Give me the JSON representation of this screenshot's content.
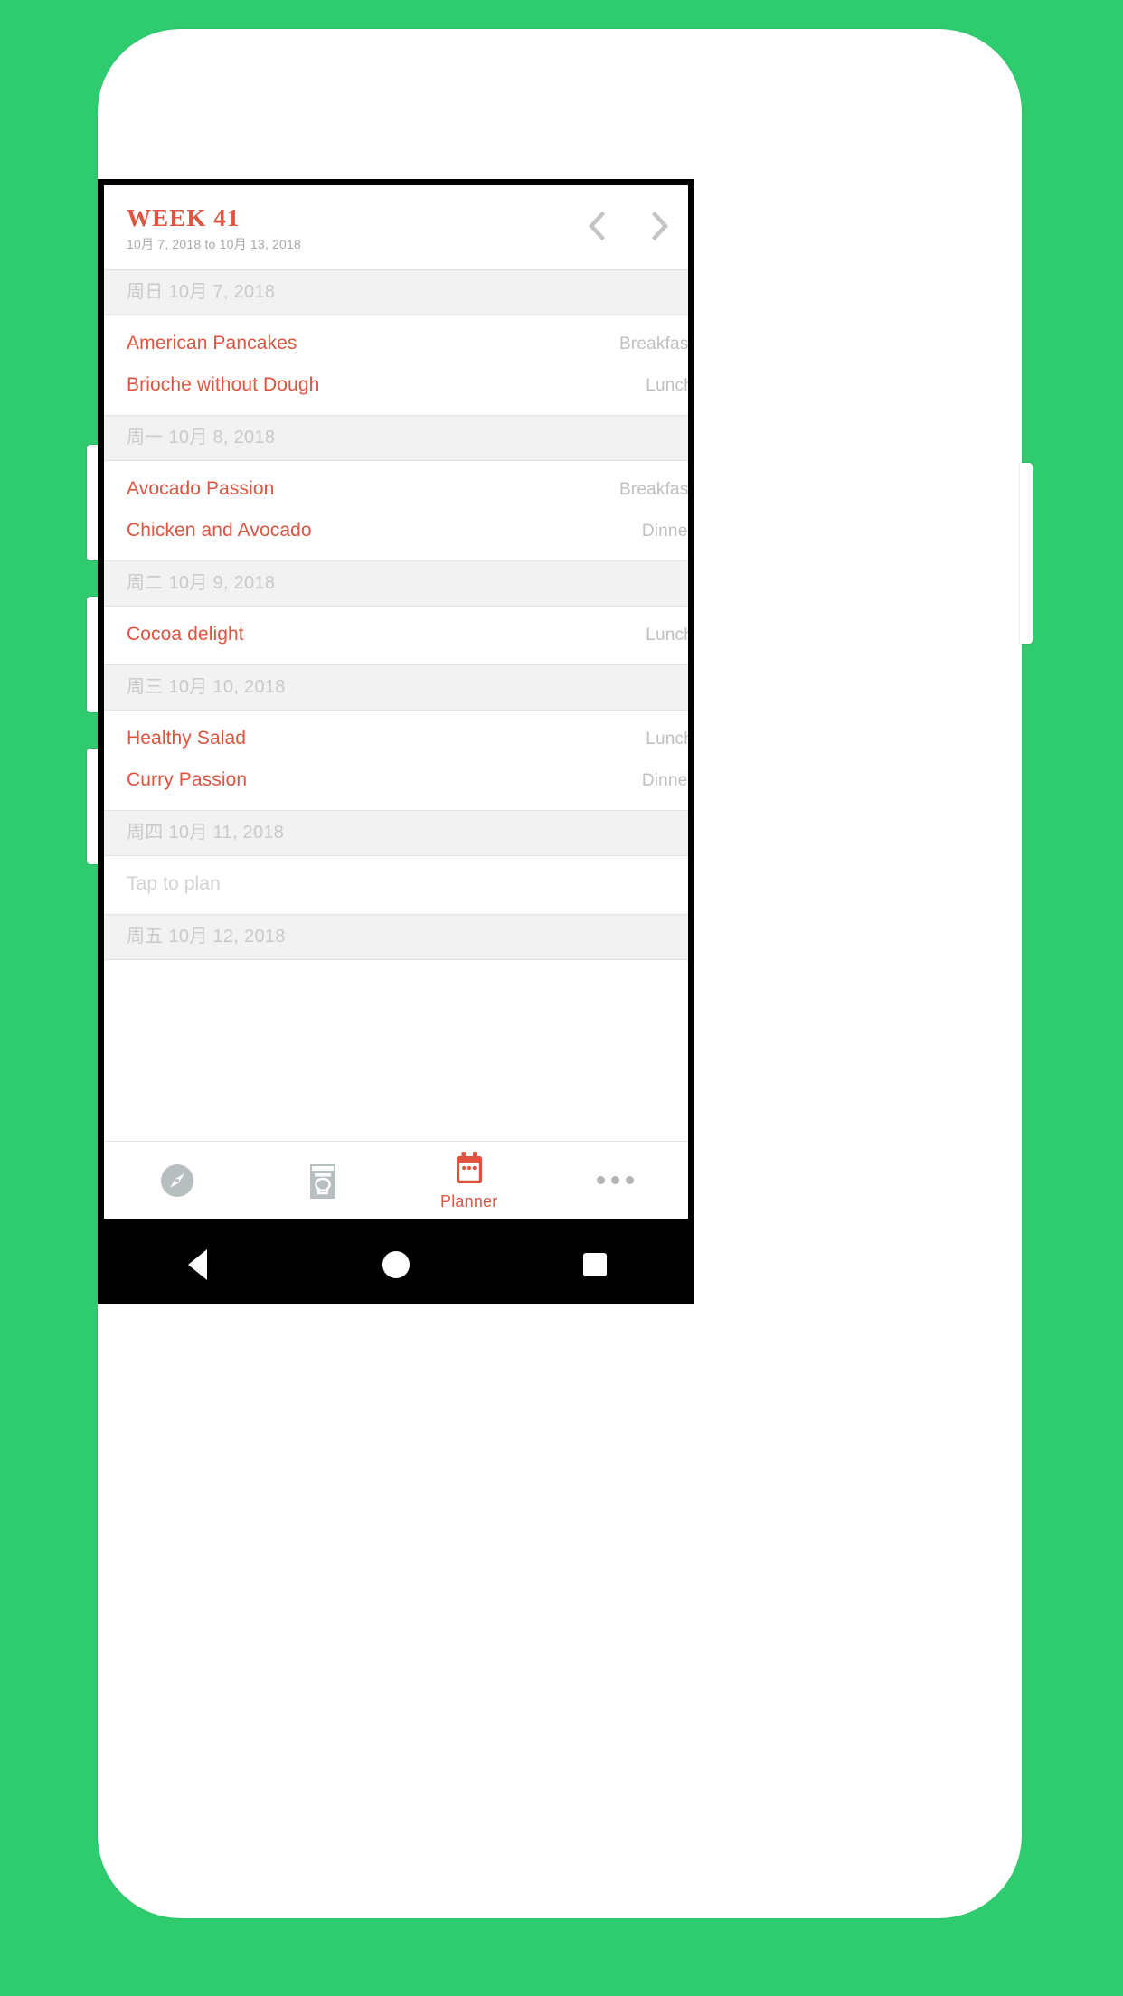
{
  "theme": {
    "background": "#2ECC6F",
    "accent": "#DD5440",
    "muted": "#BFBFBF",
    "day_header_bg": "#F2F2F2"
  },
  "header": {
    "week_title": "WEEK 41",
    "week_range": "10月 7, 2018 to 10月 13, 2018",
    "prev_label": "‹",
    "next_label": "›"
  },
  "days": [
    {
      "date_label": "周日 10月 7, 2018",
      "meals": [
        {
          "name": "American Pancakes",
          "slot": "Breakfast",
          "empty": false
        },
        {
          "name": "Brioche without Dough",
          "slot": "Lunch",
          "empty": false
        }
      ]
    },
    {
      "date_label": "周一 10月 8, 2018",
      "meals": [
        {
          "name": "Avocado Passion",
          "slot": "Breakfast",
          "empty": false
        },
        {
          "name": "Chicken and Avocado",
          "slot": "Dinner",
          "empty": false
        }
      ]
    },
    {
      "date_label": "周二 10月 9, 2018",
      "meals": [
        {
          "name": "Cocoa delight",
          "slot": "Lunch",
          "empty": false
        }
      ]
    },
    {
      "date_label": "周三 10月 10, 2018",
      "meals": [
        {
          "name": "Healthy Salad",
          "slot": "Lunch",
          "empty": false
        },
        {
          "name": "Curry Passion",
          "slot": "Dinner",
          "empty": false
        }
      ]
    },
    {
      "date_label": "周四 10月 11, 2018",
      "meals": [
        {
          "name": "Tap to plan",
          "slot": "",
          "empty": true
        }
      ]
    },
    {
      "date_label": "周五 10月 12, 2018",
      "meals": []
    }
  ],
  "tabbar": {
    "tabs": [
      {
        "icon": "compass-icon",
        "label": "",
        "active": false
      },
      {
        "icon": "cookbook-icon",
        "label": "",
        "active": false
      },
      {
        "icon": "calendar-icon",
        "label": "Planner",
        "active": true
      },
      {
        "icon": "more-icon",
        "label": "",
        "active": false
      }
    ]
  },
  "android_nav": {
    "back": "back-button",
    "home": "home-button",
    "recents": "recents-button"
  }
}
